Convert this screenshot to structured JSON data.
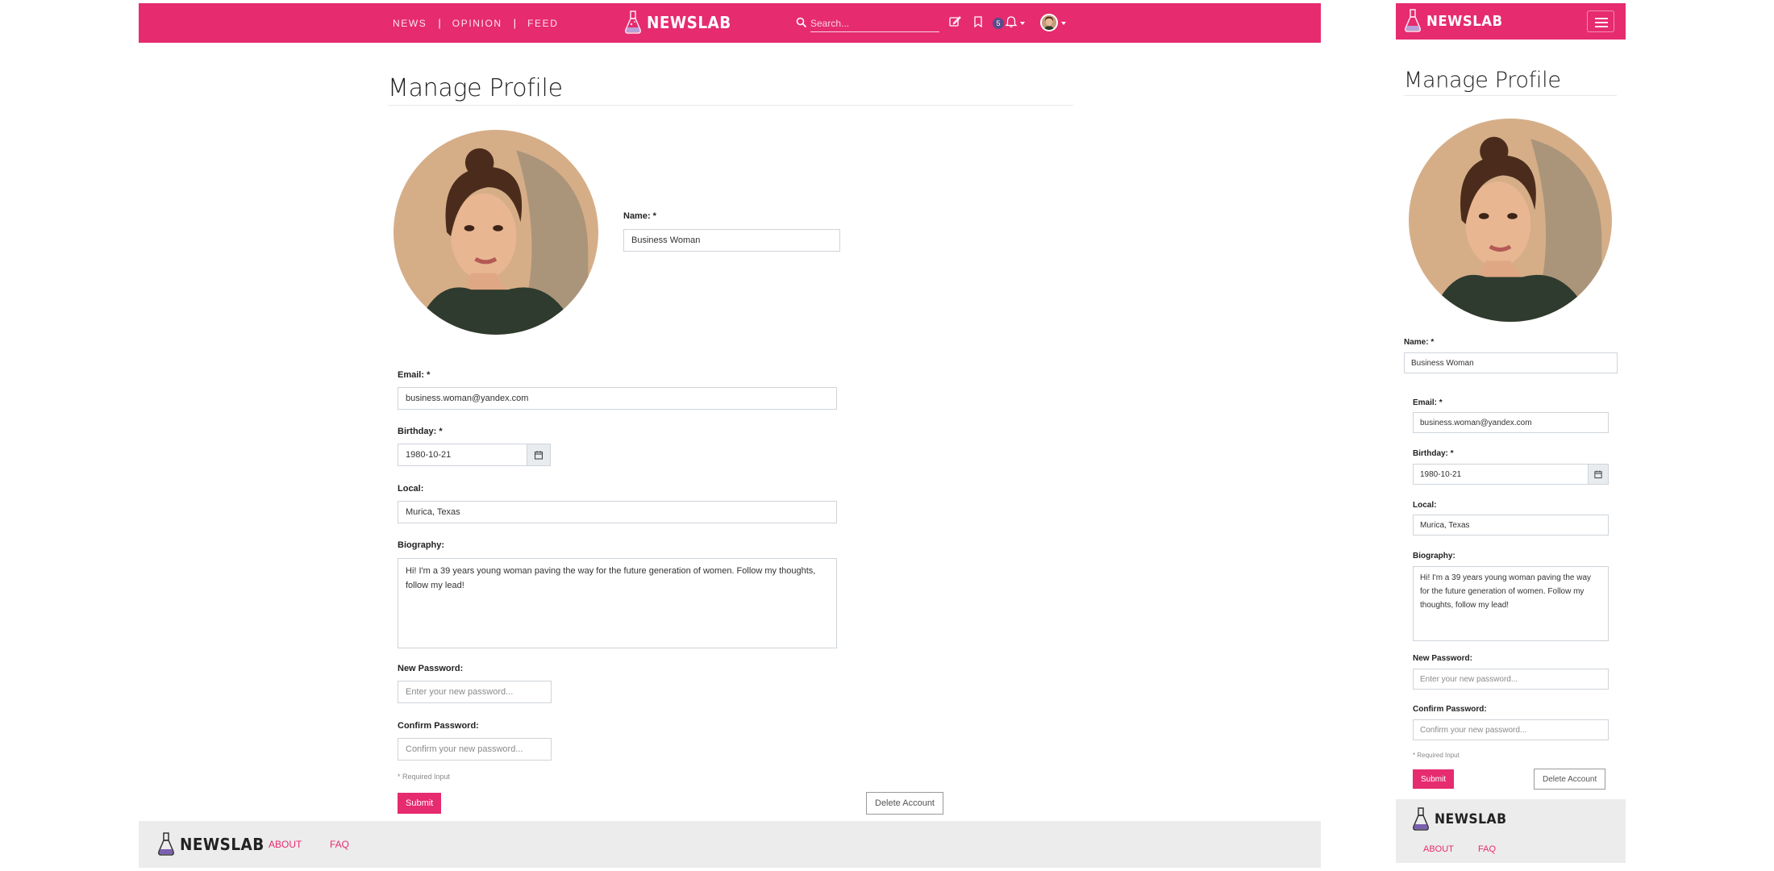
{
  "brand": {
    "name": "NEWSLAB",
    "accent": "#e62b6f"
  },
  "nav": {
    "links": [
      "NEWS",
      "OPINION",
      "FEED"
    ],
    "search_placeholder": "Search...",
    "notification_count": "5"
  },
  "page": {
    "title": "Manage Profile"
  },
  "form": {
    "name_label": "Name: *",
    "name_value": "Business Woman",
    "email_label": "Email: *",
    "email_value": "business.woman@yandex.com",
    "birthday_label": "Birthday: *",
    "birthday_value": "1980-10-21",
    "local_label": "Local:",
    "local_value": "Murica, Texas",
    "bio_label": "Biography:",
    "bio_value": "Hi! I'm a 39 years young woman paving the way for the future generation of women. Follow my thoughts, follow my lead!",
    "new_password_label": "New Password:",
    "new_password_placeholder": "Enter your new password...",
    "confirm_password_label": "Confirm Password:",
    "confirm_password_placeholder": "Confirm your new password...",
    "required_note": "* Required Input",
    "submit_label": "Submit",
    "delete_label": "Delete Account"
  },
  "footer": {
    "links": [
      "ABOUT",
      "FAQ"
    ]
  },
  "icons": [
    "flask-logo-icon",
    "search-icon",
    "edit-icon",
    "bookmark-icon",
    "bell-icon",
    "calendar-icon",
    "menu-icon"
  ]
}
